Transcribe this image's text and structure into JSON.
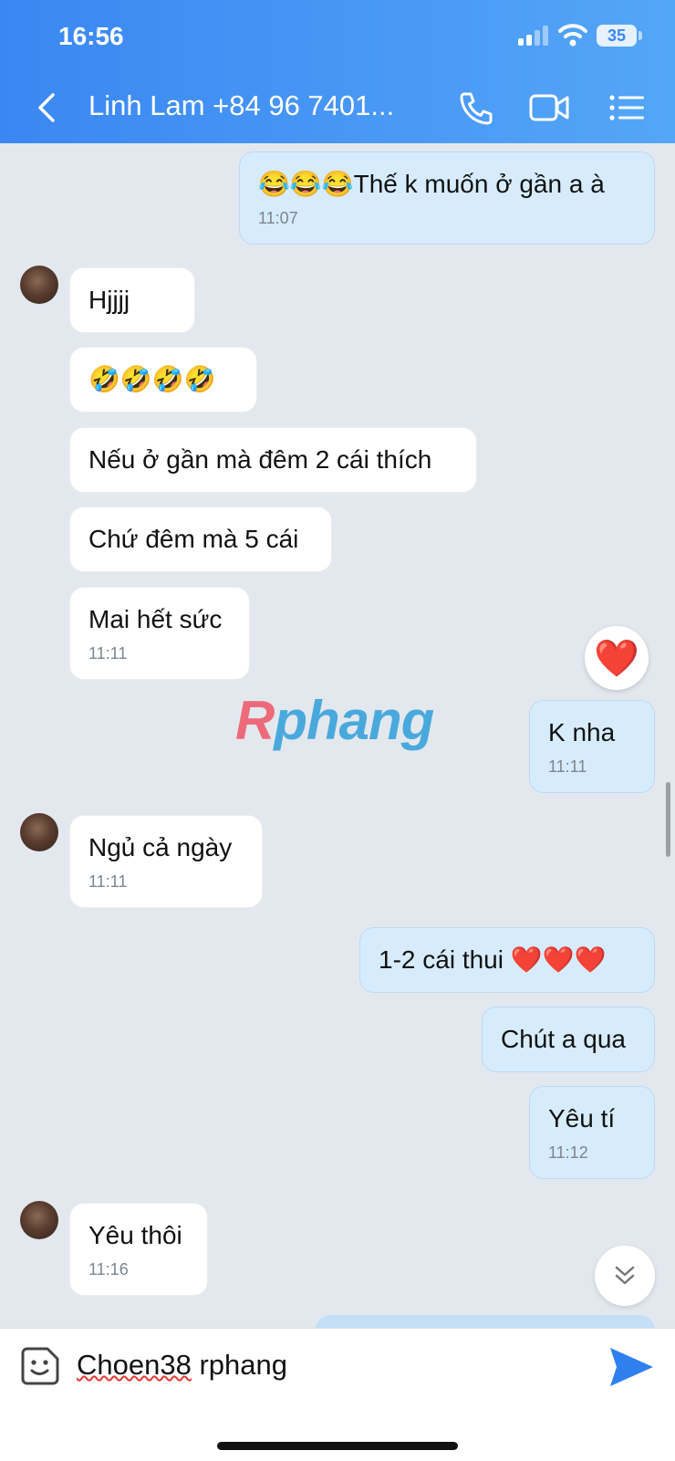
{
  "status_bar": {
    "time": "16:56",
    "battery": "35"
  },
  "header": {
    "title": "Linh Lam +84 96 7401..."
  },
  "messages": [
    {
      "dir": "out",
      "text": "😂😂😂Thế k muốn ở gần a à",
      "time": "11:07"
    },
    {
      "dir": "in",
      "text": "Hjjjj",
      "time": ""
    },
    {
      "dir": "in",
      "text": "🤣🤣🤣🤣",
      "time": ""
    },
    {
      "dir": "in",
      "text": "Nếu ở gần mà đêm 2 cái thích",
      "time": ""
    },
    {
      "dir": "in",
      "text": "Chứ đêm mà 5 cái",
      "time": ""
    },
    {
      "dir": "in",
      "text": "Mai hết sức",
      "time": "11:11"
    },
    {
      "dir": "out",
      "text": "K nha",
      "time": "11:11"
    },
    {
      "dir": "in",
      "text": "Ngủ cả ngày",
      "time": "11:11"
    },
    {
      "dir": "out",
      "text": "1-2 cái thui ❤️❤️❤️",
      "time": ""
    },
    {
      "dir": "out",
      "text": "Chút a qua",
      "time": ""
    },
    {
      "dir": "out",
      "text": "Yêu tí",
      "time": "11:12"
    },
    {
      "dir": "in",
      "text": "Yêu thôi",
      "time": "11:16"
    }
  ],
  "reaction": "❤️",
  "watermark": {
    "a": "Rphang",
    "b": ""
  },
  "composer": {
    "misspelled_word": "Choen38",
    "rest": " rphang"
  },
  "icons": [
    "back-icon",
    "phone-icon",
    "video-icon",
    "menu-icon",
    "sticker-icon",
    "send-icon",
    "scroll-down-icon"
  ],
  "colors": {
    "header": "#3a87f2",
    "outgoing_bubble": "#d6ecfd",
    "incoming_bubble": "#ffffff",
    "background": "#e3e8ef",
    "send": "#2f7fef"
  }
}
